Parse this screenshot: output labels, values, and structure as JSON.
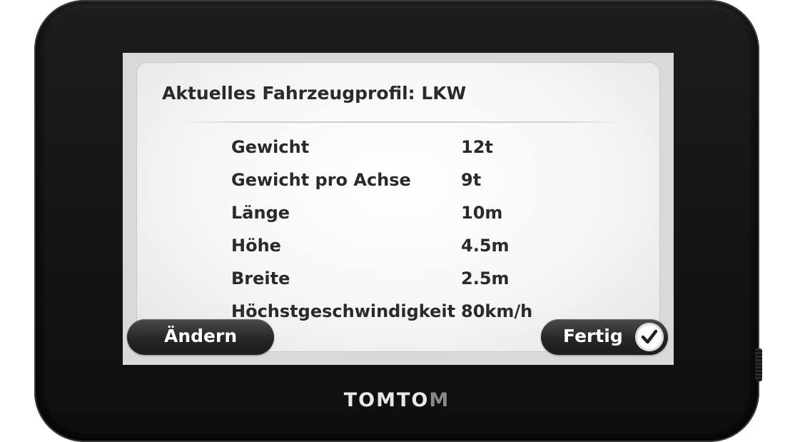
{
  "screen": {
    "title": "Aktuelles Fahrzeugprofil: LKW",
    "specs": [
      {
        "label": "Gewicht",
        "value": "12t"
      },
      {
        "label": "Gewicht pro Achse",
        "value": "9t"
      },
      {
        "label": "Länge",
        "value": "10m"
      },
      {
        "label": "Höhe",
        "value": "4.5m"
      },
      {
        "label": "Breite",
        "value": "2.5m"
      },
      {
        "label": "Höchstgeschwindigkeit",
        "value": "80km/h"
      }
    ],
    "buttons": {
      "change_label": "Ändern",
      "done_label": "Fertig",
      "done_icon": "checkmark-icon"
    }
  },
  "device": {
    "brand_main": "TOMTO",
    "brand_tail": "M"
  },
  "colors": {
    "button_bg": "#262626",
    "text": "#2a2a2a",
    "bezel": "#111111"
  }
}
